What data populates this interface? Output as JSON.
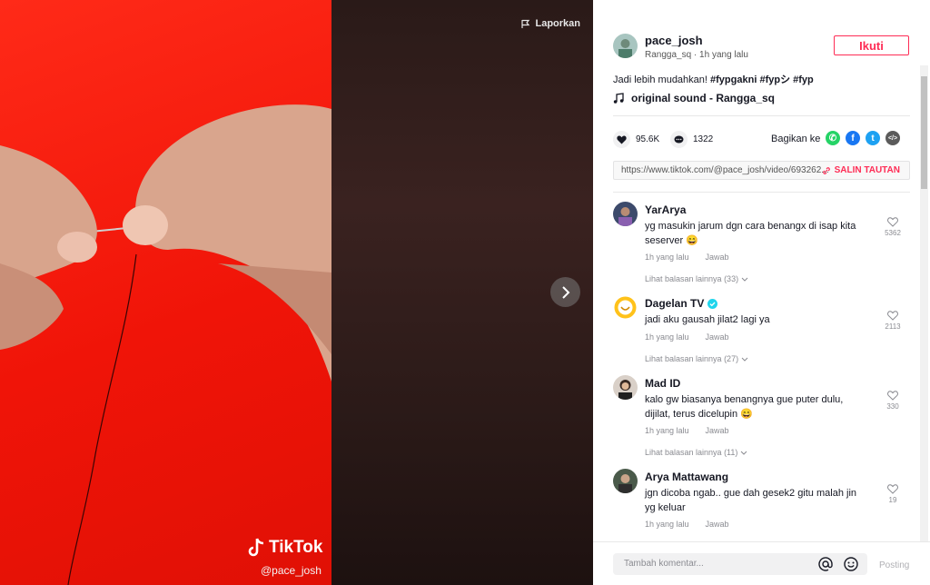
{
  "video": {
    "report_label": "Laporkan",
    "watermark_brand": "TikTok",
    "watermark_user": "@pace_josh"
  },
  "author": {
    "username": "pace_josh",
    "subtitle": "Rangga_sq · 1h yang lalu",
    "follow_label": "Ikuti"
  },
  "post": {
    "caption_text": "Jadi lebih mudahkan!",
    "hashtags": [
      "#fypgakni",
      "#fypシ",
      "#fyp"
    ],
    "music": "original sound - Rangga_sq",
    "likes": "95.6K",
    "comments_count": "1322",
    "share_label": "Bagikan ke",
    "link": "https://www.tiktok.com/@pace_josh/video/693262...",
    "copy_label": "SALIN TAUTAN"
  },
  "comments": [
    {
      "name": "YarArya",
      "text": "yg masukin jarum dgn cara benangx di isap kita seserver 😄",
      "time": "1h yang lalu",
      "reply": "Jawab",
      "likes": "5362",
      "more": "Lihat balasan lainnya (33)",
      "verified": false
    },
    {
      "name": "Dagelan TV",
      "text": "jadi aku gausah jilat2 lagi ya",
      "time": "1h yang lalu",
      "reply": "Jawab",
      "likes": "2113",
      "more": "Lihat balasan lainnya (27)",
      "verified": true
    },
    {
      "name": "Mad ID",
      "text": "kalo gw biasanya benangnya gue puter dulu, dijilat, terus dicelupin 😄",
      "time": "1h yang lalu",
      "reply": "Jawab",
      "likes": "330",
      "more": "Lihat balasan lainnya (11)",
      "verified": false
    },
    {
      "name": "Arya Mattawang",
      "text": "jgn dicoba ngab.. gue dah gesek2 gitu malah jin yg keluar",
      "time": "1h yang lalu",
      "reply": "Jawab",
      "likes": "19",
      "more": "",
      "verified": false
    }
  ],
  "comment_bar": {
    "placeholder": "Tambah komentar...",
    "post_label": "Posting"
  },
  "colors": {
    "accent": "#fe2c55",
    "verified": "#20d5ec"
  }
}
